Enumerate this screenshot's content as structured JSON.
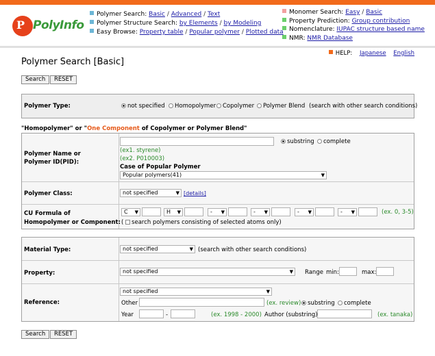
{
  "header": {
    "logo_text": "PolyInfo",
    "logo_mark": "P",
    "nav_left": [
      {
        "label": "Polymer Search:",
        "links": [
          "Basic",
          "Advanced",
          "Text"
        ]
      },
      {
        "label": "Polymer Structure Search:",
        "links": [
          "by Elements",
          "by Modeling"
        ]
      },
      {
        "label": "Easy Browse:",
        "links": [
          "Property table",
          "Popular polymer",
          "Plotted data"
        ]
      }
    ],
    "nav_right": [
      {
        "label": "Monomer Search:",
        "links": [
          "Easy",
          "Basic"
        ]
      },
      {
        "label": "Property Prediction:",
        "links": [
          "Group contribution"
        ]
      },
      {
        "label": "Nomenclature:",
        "links": [
          "IUPAC structure based name"
        ]
      },
      {
        "label": "NMR:",
        "links": [
          "NMR Database"
        ]
      }
    ]
  },
  "help": {
    "label": "HELP:",
    "japanese": "Japanese",
    "english": "English"
  },
  "page_title": "Polymer Search [Basic]",
  "buttons": {
    "search": "Search",
    "reset": "RESET"
  },
  "polymer_type": {
    "label": "Polymer Type:",
    "options": [
      "not specified",
      "Homopolymer",
      "Copolymer",
      "Polymer Blend"
    ],
    "selected": "not specified",
    "note": "(search with other search conditions)"
  },
  "section_heading": {
    "part1": "\"Homopolymer\" or \"",
    "highlight": "One Component",
    "part2": " of Copolymer or Polymer Blend\""
  },
  "polymer_name": {
    "label1": "Polymer Name or",
    "label2": "Polymer ID(PID):",
    "value": "",
    "match_options": [
      "substring",
      "complete"
    ],
    "ex1": "(ex1. styrene)",
    "ex2": "(ex2. P010003)",
    "popular_label": "Case of Popular Polymer",
    "popular_value": "Popular polymers(41)"
  },
  "polymer_class": {
    "label": "Polymer Class:",
    "value": "not specified",
    "details": "[details]"
  },
  "cu_formula": {
    "label1": "CU Formula of",
    "label2": "Homopolymer or Component:",
    "atoms": [
      "C",
      "H",
      "-",
      "-",
      "-",
      "-"
    ],
    "example": "(ex. 0, 3-5)",
    "checkbox_label": "search polymers consisting of selected atoms only)",
    "paren_open": "("
  },
  "material_type": {
    "label": "Material Type:",
    "value": "not specified",
    "note": "(search with other search conditions)"
  },
  "property": {
    "label": "Property:",
    "value": "not specified",
    "range": "Range",
    "min": "min:",
    "max": "max:"
  },
  "reference": {
    "label": "Reference:",
    "value": "not specified",
    "other": "Other",
    "other_ex": "(ex. review)",
    "match_options": [
      "substring",
      "complete"
    ],
    "year": "Year",
    "year_sep": "-",
    "year_ex": "(ex. 1998 - 2000)",
    "author": "Author (substring)",
    "author_ex": "(ex. tanaka)"
  },
  "colors": {
    "top_bar": "#f26a1b",
    "link": "#1a1aa6",
    "example": "#2a8a2a",
    "highlight": "#e65a1a"
  }
}
